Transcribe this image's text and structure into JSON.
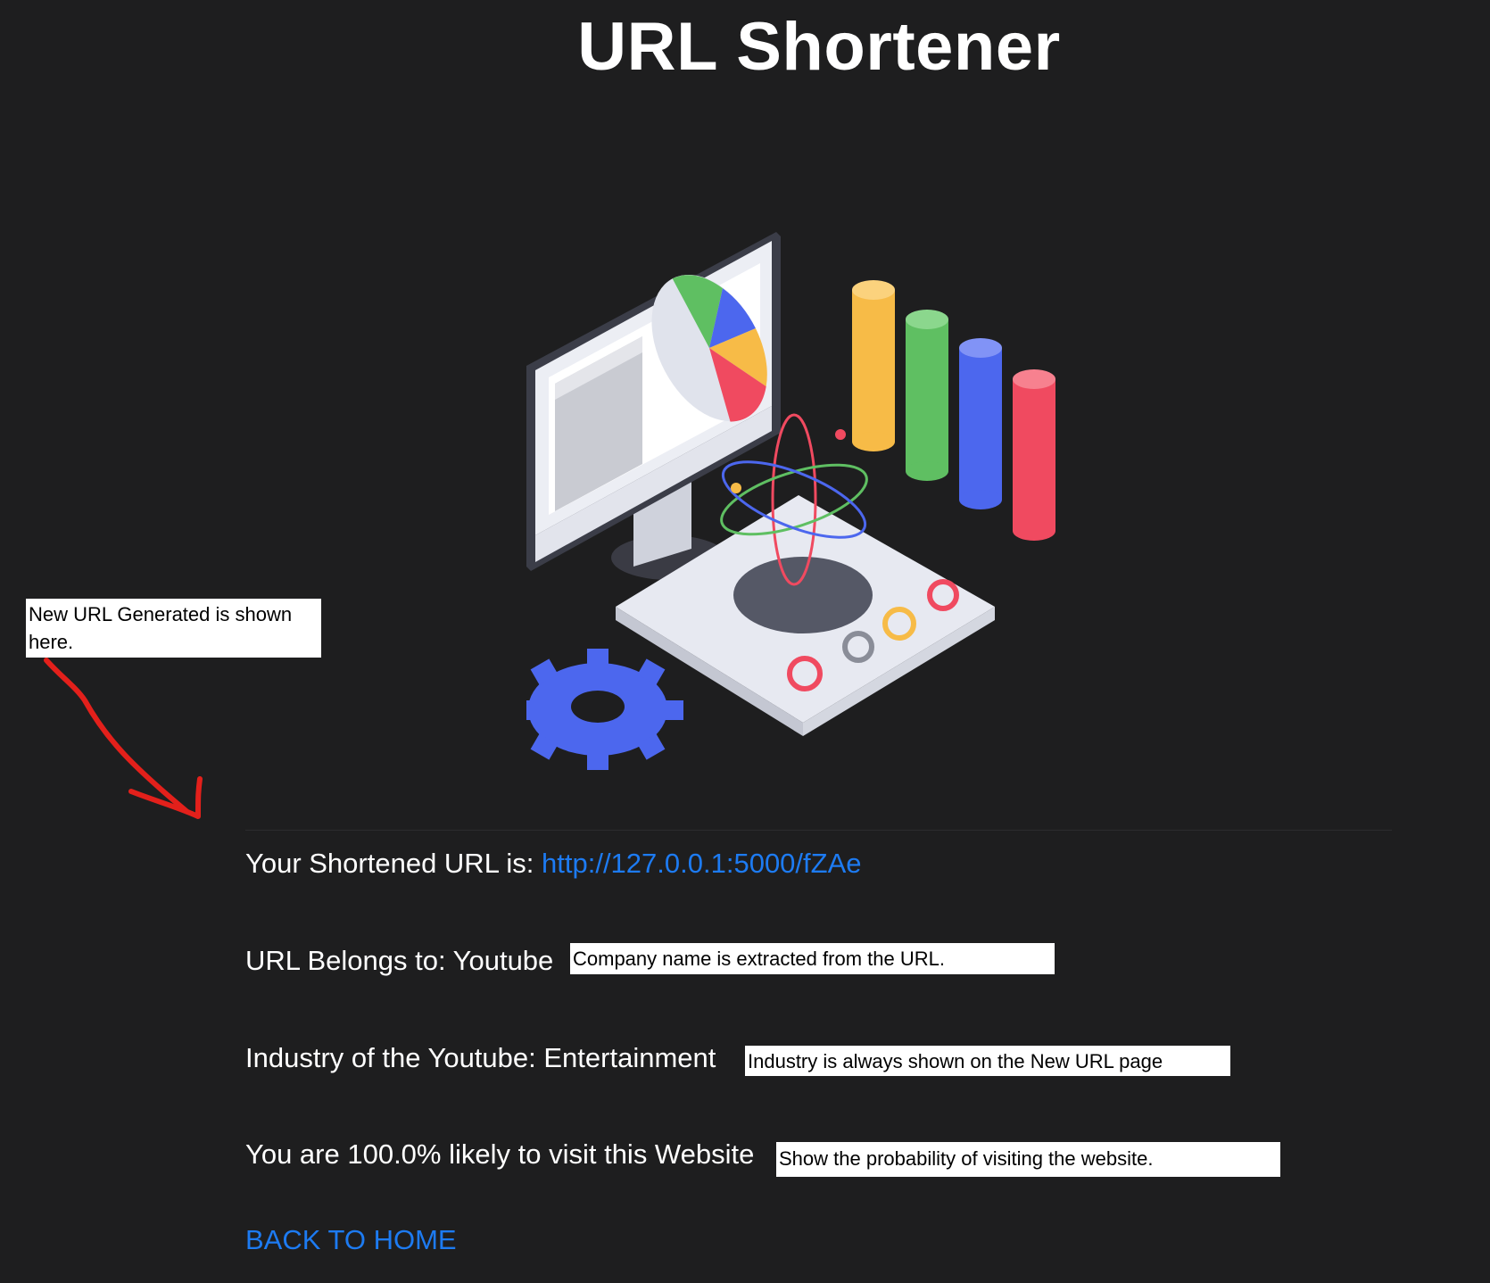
{
  "header": {
    "title": "URL Shortener"
  },
  "result": {
    "shortened_label": "Your Shortened URL is: ",
    "shortened_url": "http://127.0.0.1:5000/fZAe",
    "belongs_label": "URL Belongs to: ",
    "company": "Youtube",
    "industry_label": "Industry of the Youtube: ",
    "industry": "Entertainment",
    "probability_text": "You are 100.0% likely to visit this Website",
    "back_link": "BACK TO HOME"
  },
  "annotations": {
    "new_url_note": "New URL Generated is shown here.",
    "company_note": "Company name is extracted from the URL.",
    "industry_note": "Industry is always shown on the New URL page",
    "probability_note": "Show the probability of visiting the website."
  },
  "colors": {
    "background": "#1e1e1f",
    "link": "#1d7bf2",
    "annotation_arrow": "#e3201b",
    "bar_yellow": "#f7bb47",
    "bar_green": "#5fbf62",
    "bar_blue": "#4c67ee",
    "bar_red": "#f04a60"
  },
  "icons": {
    "hero": "analytics-workstation-illustration",
    "gear": "gear-icon",
    "arrow": "annotation-arrow"
  }
}
